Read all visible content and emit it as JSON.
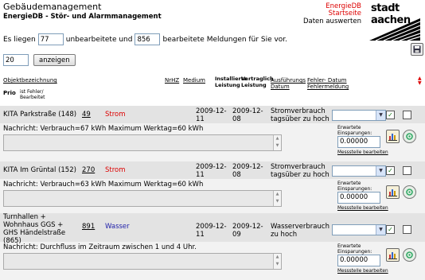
{
  "header": {
    "title": "Gebäudemanagement",
    "subtitle": "EnergieDB - Stör- und Alarmmanagement",
    "links": {
      "energiedb": "EnergieDB",
      "startseite": "Startseite",
      "daten": "Daten auswerten"
    },
    "logo_text": "stadt aachen"
  },
  "intro": {
    "prefix": "Es liegen",
    "unprocessed": "77",
    "middle": "unbearbeitete und",
    "processed": "856",
    "suffix": "bearbeitete Meldungen für Sie vor."
  },
  "controls": {
    "count": "20",
    "show_label": "anzeigen"
  },
  "columns": {
    "objekt": "Objektbezeichnung",
    "nrhz": "NrHZ",
    "medium": "Medium",
    "installiert": "Installierte Leistung",
    "vertraglich": "Vertraglich Leistung",
    "ausfuehrungs": "Ausführungs Datum",
    "fehler": "Fehler- Datum Fehlermeldung",
    "prio": "Prio",
    "ist_fehler": "ist Fehler/",
    "bearbeitet": "Bearbeitet"
  },
  "rows": [
    {
      "name": "KITA Parkstraße (148)",
      "nr": "49",
      "medium": "Strom",
      "date1": "2009-12-11",
      "date2": "2009-12-08",
      "message_title": "Stromverbrauch tagsüber zu hoch",
      "checked": true,
      "note": "Nachricht: Verbrauch=67 kWh Maximum Werktag=60 kWh",
      "savings_label": "Erwartete Einsparungen:",
      "savings_value": "0.00000",
      "messstelle_link": "Messstelle bearbeiten"
    },
    {
      "name": "KITA Im Grüntal (152)",
      "nr": "270",
      "medium": "Strom",
      "date1": "2009-12-11",
      "date2": "2009-12-08",
      "message_title": "Stromverbrauch tagsüber zu hoch",
      "checked": true,
      "note": "Nachricht: Verbrauch=63 kWh Maximum Werktag=60 kWh",
      "savings_label": "Erwartete Einsparungen:",
      "savings_value": "0.00000",
      "messstelle_link": "Messstelle bearbeiten"
    },
    {
      "name": "Turnhallen + Wohnhaus GGS + GHS Händelstraße (865)",
      "nr": "891",
      "medium": "Wasser",
      "date1": "2009-12-11",
      "date2": "2009-12-09",
      "message_title": "Wasserverbrauch zu hoch",
      "checked": true,
      "note": "Nachricht: Durchfluss im Zeitraum zwischen 1 und 4 Uhr.",
      "savings_label": "Erwartete Einsparungen:",
      "savings_value": "0.00000",
      "messstelle_link": "Messstelle bearbeiten"
    }
  ],
  "colors": {
    "strom": "#dd0000",
    "wasser": "#2222aa",
    "link_red": "#dd0000",
    "row_header_bg": "#e3e3e3",
    "row_note_bg": "#f2f2f2"
  }
}
